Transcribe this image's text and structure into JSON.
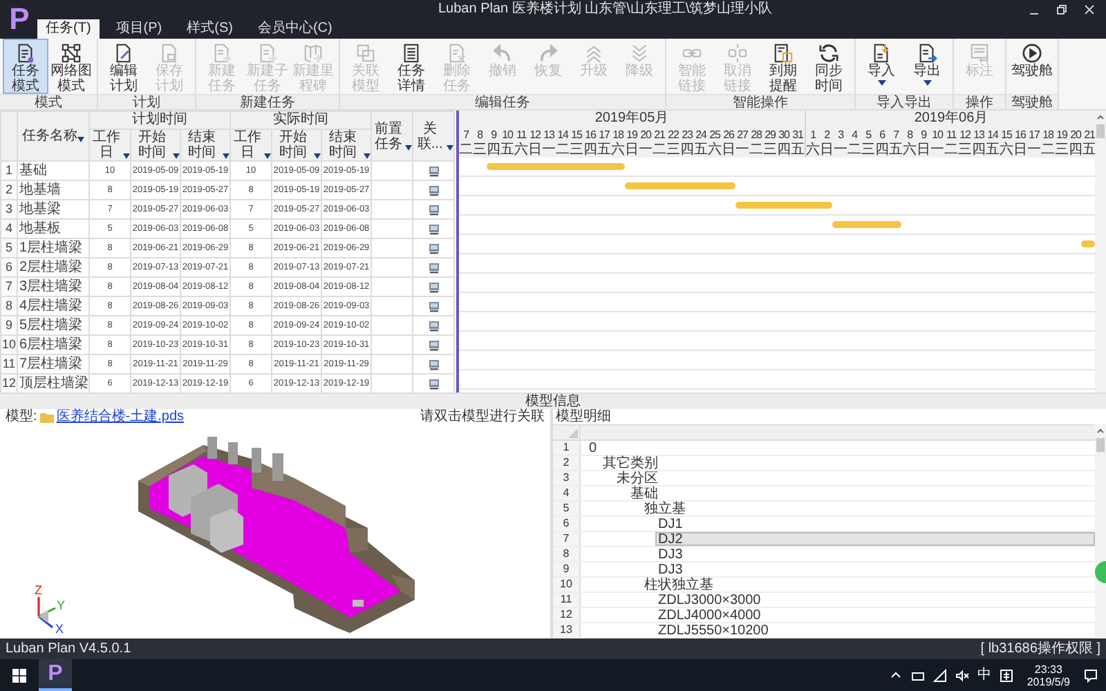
{
  "window": {
    "logo": "P",
    "title": "Luban Plan 医养楼计划 山东管\\山东理工\\筑梦山理小队"
  },
  "tabs": [
    {
      "label": "任务(T)",
      "selected": true
    },
    {
      "label": "项目(P)",
      "selected": false
    },
    {
      "label": "样式(S)",
      "selected": false
    },
    {
      "label": "会员中心(C)",
      "selected": false
    }
  ],
  "ribbon": [
    {
      "group": "模式",
      "buttons": [
        {
          "label": "任务模式",
          "selected": true,
          "disabled": false,
          "dropdown": false
        },
        {
          "label": "网络图模式",
          "selected": false,
          "disabled": false,
          "dropdown": false
        }
      ]
    },
    {
      "group": "计划",
      "buttons": [
        {
          "label": "编辑计划",
          "selected": false,
          "disabled": false,
          "dropdown": false
        },
        {
          "label": "保存计划",
          "selected": false,
          "disabled": true,
          "dropdown": false
        }
      ]
    },
    {
      "group": "新建任务",
      "buttons": [
        {
          "label": "新建任务",
          "selected": false,
          "disabled": true,
          "dropdown": false
        },
        {
          "label": "新建子任务",
          "selected": false,
          "disabled": true,
          "dropdown": false
        },
        {
          "label": "新建里程碑",
          "selected": false,
          "disabled": true,
          "dropdown": false
        }
      ]
    },
    {
      "group": "编辑任务",
      "buttons": [
        {
          "label": "关联模型",
          "selected": false,
          "disabled": true,
          "dropdown": false
        },
        {
          "label": "任务详情",
          "selected": false,
          "disabled": false,
          "dropdown": false
        },
        {
          "label": "删除任务",
          "selected": false,
          "disabled": true,
          "dropdown": false
        },
        {
          "label": "撤销",
          "selected": false,
          "disabled": true,
          "dropdown": false
        },
        {
          "label": "恢复",
          "selected": false,
          "disabled": true,
          "dropdown": false
        },
        {
          "label": "升级",
          "selected": false,
          "disabled": true,
          "dropdown": false
        },
        {
          "label": "降级",
          "selected": false,
          "disabled": true,
          "dropdown": false
        }
      ]
    },
    {
      "group": "智能操作",
      "buttons": [
        {
          "label": "智能链接",
          "selected": false,
          "disabled": true,
          "dropdown": false
        },
        {
          "label": "取消链接",
          "selected": false,
          "disabled": true,
          "dropdown": false
        },
        {
          "label": "到期提醒",
          "selected": false,
          "disabled": false,
          "dropdown": false
        },
        {
          "label": "同步时间",
          "selected": false,
          "disabled": false,
          "dropdown": false
        }
      ]
    },
    {
      "group": "导入导出",
      "buttons": [
        {
          "label": "导入",
          "selected": false,
          "disabled": false,
          "dropdown": true
        },
        {
          "label": "导出",
          "selected": false,
          "disabled": false,
          "dropdown": true
        }
      ]
    },
    {
      "group": "操作",
      "buttons": [
        {
          "label": "标注",
          "selected": false,
          "disabled": true,
          "dropdown": false
        }
      ]
    },
    {
      "group": "驾驶舱",
      "buttons": [
        {
          "label": "驾驶舱",
          "selected": false,
          "disabled": false,
          "dropdown": false
        }
      ]
    }
  ],
  "task_table": {
    "name_header": "任务名称",
    "groups": [
      {
        "label": "计划时间",
        "columns": [
          "工作日",
          "开始时间",
          "结束时间"
        ]
      },
      {
        "label": "实际时间",
        "columns": [
          "工作日",
          "开始时间",
          "结束时间"
        ]
      }
    ],
    "predecessor_header": "前置任务",
    "link_header": "关联...",
    "rows": [
      {
        "num": "1",
        "name": "基础",
        "plan": [
          "10",
          "2019-05-09",
          "2019-05-19"
        ],
        "actual": [
          "10",
          "2019-05-09",
          "2019-05-19"
        ]
      },
      {
        "num": "2",
        "name": "地基墙",
        "plan": [
          "8",
          "2019-05-19",
          "2019-05-27"
        ],
        "actual": [
          "8",
          "2019-05-19",
          "2019-05-27"
        ]
      },
      {
        "num": "3",
        "name": "地基梁",
        "plan": [
          "7",
          "2019-05-27",
          "2019-06-03"
        ],
        "actual": [
          "7",
          "2019-05-27",
          "2019-06-03"
        ]
      },
      {
        "num": "4",
        "name": "地基板",
        "plan": [
          "5",
          "2019-06-03",
          "2019-06-08"
        ],
        "actual": [
          "5",
          "2019-06-03",
          "2019-06-08"
        ]
      },
      {
        "num": "5",
        "name": "1层柱墙梁",
        "plan": [
          "8",
          "2019-06-21",
          "2019-06-29"
        ],
        "actual": [
          "8",
          "2019-06-21",
          "2019-06-29"
        ]
      },
      {
        "num": "6",
        "name": "2层柱墙梁",
        "plan": [
          "8",
          "2019-07-13",
          "2019-07-21"
        ],
        "actual": [
          "8",
          "2019-07-13",
          "2019-07-21"
        ]
      },
      {
        "num": "7",
        "name": "3层柱墙梁",
        "plan": [
          "8",
          "2019-08-04",
          "2019-08-12"
        ],
        "actual": [
          "8",
          "2019-08-04",
          "2019-08-12"
        ]
      },
      {
        "num": "8",
        "name": "4层柱墙梁",
        "plan": [
          "8",
          "2019-08-26",
          "2019-09-03"
        ],
        "actual": [
          "8",
          "2019-08-26",
          "2019-09-03"
        ]
      },
      {
        "num": "9",
        "name": "5层柱墙梁",
        "plan": [
          "8",
          "2019-09-24",
          "2019-10-02"
        ],
        "actual": [
          "8",
          "2019-09-24",
          "2019-10-02"
        ]
      },
      {
        "num": "10",
        "name": "6层柱墙梁",
        "plan": [
          "8",
          "2019-10-23",
          "2019-10-31"
        ],
        "actual": [
          "8",
          "2019-10-23",
          "2019-10-31"
        ]
      },
      {
        "num": "11",
        "name": "7层柱墙梁",
        "plan": [
          "8",
          "2019-11-21",
          "2019-11-29"
        ],
        "actual": [
          "8",
          "2019-11-21",
          "2019-11-29"
        ]
      },
      {
        "num": "12",
        "name": "顶层柱墙梁",
        "plan": [
          "6",
          "2019-12-13",
          "2019-12-19"
        ],
        "actual": [
          "6",
          "2019-12-13",
          "2019-12-19"
        ]
      }
    ]
  },
  "gantt": {
    "months": [
      {
        "label": "2019年05月",
        "days": [
          {
            "d": "7",
            "w": "二"
          },
          {
            "d": "8",
            "w": "三"
          },
          {
            "d": "9",
            "w": "四"
          },
          {
            "d": "10",
            "w": "五"
          },
          {
            "d": "11",
            "w": "六"
          },
          {
            "d": "12",
            "w": "日"
          },
          {
            "d": "13",
            "w": "一"
          },
          {
            "d": "14",
            "w": "二"
          },
          {
            "d": "15",
            "w": "三"
          },
          {
            "d": "16",
            "w": "四"
          },
          {
            "d": "17",
            "w": "五"
          },
          {
            "d": "18",
            "w": "六"
          },
          {
            "d": "19",
            "w": "日"
          },
          {
            "d": "20",
            "w": "一"
          },
          {
            "d": "21",
            "w": "二"
          },
          {
            "d": "22",
            "w": "三"
          },
          {
            "d": "23",
            "w": "四"
          },
          {
            "d": "24",
            "w": "五"
          },
          {
            "d": "25",
            "w": "六"
          },
          {
            "d": "26",
            "w": "日"
          },
          {
            "d": "27",
            "w": "一"
          },
          {
            "d": "28",
            "w": "二"
          },
          {
            "d": "29",
            "w": "三"
          },
          {
            "d": "30",
            "w": "四"
          },
          {
            "d": "31",
            "w": "五"
          }
        ]
      },
      {
        "label": "2019年06月",
        "days": [
          {
            "d": "1",
            "w": "六"
          },
          {
            "d": "2",
            "w": "日"
          },
          {
            "d": "3",
            "w": "一"
          },
          {
            "d": "4",
            "w": "二"
          },
          {
            "d": "5",
            "w": "三"
          },
          {
            "d": "6",
            "w": "四"
          },
          {
            "d": "7",
            "w": "五"
          },
          {
            "d": "8",
            "w": "六"
          },
          {
            "d": "9",
            "w": "日"
          },
          {
            "d": "10",
            "w": "一"
          },
          {
            "d": "11",
            "w": "二"
          },
          {
            "d": "12",
            "w": "三"
          },
          {
            "d": "13",
            "w": "四"
          },
          {
            "d": "14",
            "w": "五"
          },
          {
            "d": "15",
            "w": "六"
          },
          {
            "d": "16",
            "w": "日"
          },
          {
            "d": "17",
            "w": "一"
          },
          {
            "d": "18",
            "w": "二"
          },
          {
            "d": "19",
            "w": "三"
          },
          {
            "d": "20",
            "w": "四"
          },
          {
            "d": "21",
            "w": "五"
          }
        ]
      }
    ]
  },
  "section_title": "模型信息",
  "model_panel": {
    "label": "模型:",
    "file": "医养结合楼-土建.pds",
    "hint": "请双击模型进行关联",
    "axes": [
      "Z",
      "Y",
      "X"
    ]
  },
  "detail_panel": {
    "label": "模型明细",
    "tree": [
      {
        "num": "1",
        "text": "0",
        "selected": false,
        "children": [
          {
            "num": "2",
            "text": "其它类别",
            "selected": false,
            "children": [
              {
                "num": "3",
                "text": "未分区",
                "selected": false,
                "children": [
                  {
                    "num": "4",
                    "text": "基础",
                    "selected": false,
                    "children": [
                      {
                        "num": "5",
                        "text": "独立基",
                        "selected": false,
                        "children": [
                          {
                            "num": "6",
                            "text": "DJ1",
                            "selected": false
                          },
                          {
                            "num": "7",
                            "text": "DJ2",
                            "selected": true
                          },
                          {
                            "num": "8",
                            "text": "DJ3",
                            "selected": false
                          },
                          {
                            "num": "9",
                            "text": "DJ3",
                            "selected": false
                          }
                        ]
                      },
                      {
                        "num": "10",
                        "text": "柱状独立基",
                        "selected": false,
                        "children": [
                          {
                            "num": "11",
                            "text": "ZDLJ3000×3000",
                            "selected": false
                          },
                          {
                            "num": "12",
                            "text": "ZDLJ4000×4000",
                            "selected": false
                          },
                          {
                            "num": "13",
                            "text": "ZDLJ5550×10200",
                            "selected": false
                          }
                        ]
                      }
                    ]
                  }
                ]
              }
            ]
          }
        ]
      }
    ]
  },
  "status_bar": {
    "version": "Luban Plan V4.5.0.1",
    "user": "[ lb31686操作权限 ]"
  },
  "taskbar": {
    "app_logo": "P",
    "ime": "中",
    "time": "23:33",
    "date": "2019/5/9"
  }
}
